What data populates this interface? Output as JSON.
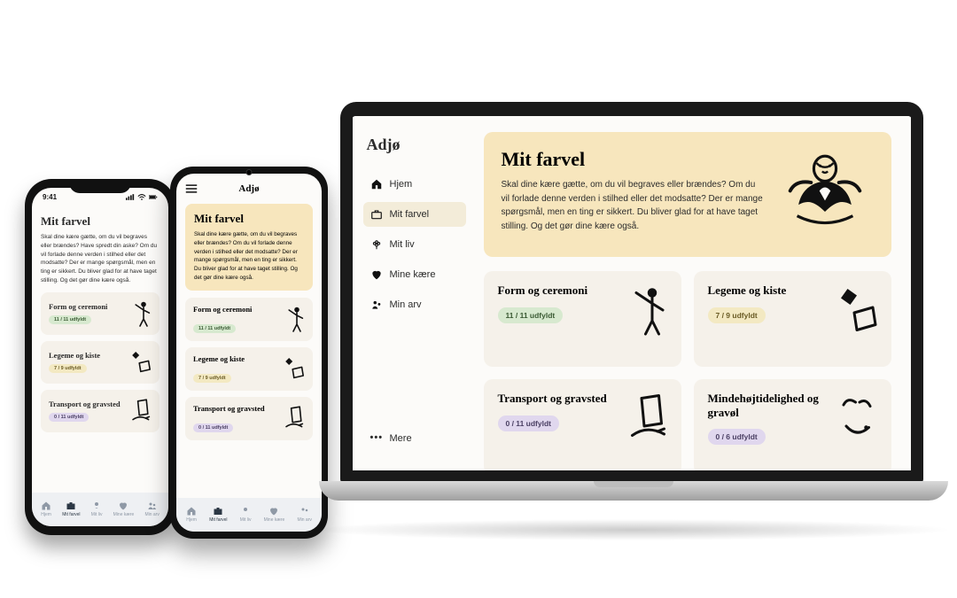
{
  "brand": "Adjø",
  "phone_status": {
    "time": "9:41"
  },
  "nav": {
    "home": "Hjem",
    "farvel": "Mit farvel",
    "liv": "Mit liv",
    "kaere": "Mine kære",
    "arv": "Min arv",
    "more": "Mere"
  },
  "hero": {
    "title": "Mit farvel",
    "body_laptop": "Skal dine kære gætte, om du vil begraves eller brændes? Om du vil forlade denne verden i stilhed eller det modsatte? Der er mange spørgsmål, men en ting er sikkert. Du bliver glad for at have taget stilling. Og det gør dine kære også.",
    "body_phone1": "Skal dine kære gætte, om du vil begraves eller brændes? Have spredt din aske? Om du vil forlade denne verden i stilhed eller det modsatte? Der er mange spørgsmål, men en ting er sikkert. Du bliver glad for at have taget stilling. Og det gør dine kære også.",
    "body_phone2": "Skal dine kære gætte, om du vil begraves eller brændes? Om du vil forlade denne verden i stilhed eller det modsatte? Der er mange spørgsmål, men en ting er sikkert. Du bliver glad for at have taget stilling. Og det gør dine kære også."
  },
  "cards": {
    "form": {
      "title": "Form og ceremoni",
      "pill": "11 / 11 udfyldt",
      "color": "green"
    },
    "legeme": {
      "title": "Legeme og kiste",
      "pill": "7 / 9 udfyldt",
      "color": "yellow"
    },
    "transport": {
      "title": "Transport og gravsted",
      "pill": "0 / 11 udfyldt",
      "color": "purple"
    },
    "minde": {
      "title": "Mindehøjtidelighed og gravøl",
      "pill": "0 / 6 udfyldt",
      "color": "purple"
    }
  }
}
